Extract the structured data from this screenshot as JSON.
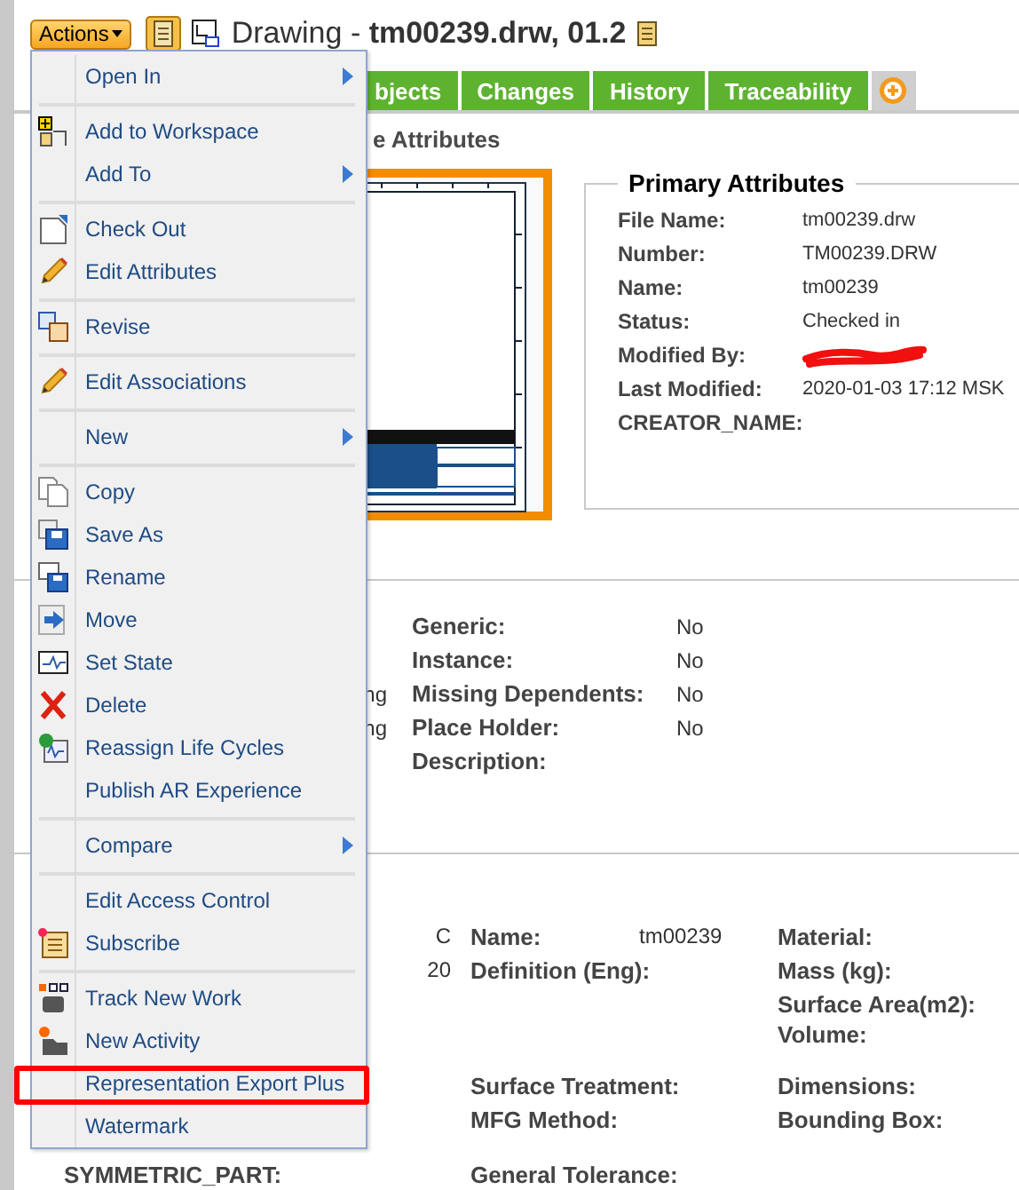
{
  "header": {
    "actions_button": "Actions",
    "title": "Drawing - **tm00239.drw, 01.2**"
  },
  "tabs": [
    {
      "label": "bjects",
      "selected": false
    },
    {
      "label": "Changes",
      "selected": false
    },
    {
      "label": "History",
      "selected": false
    },
    {
      "label": "Traceability",
      "selected": false
    }
  ],
  "section_title": "e Attributes",
  "primary_attributes": {
    "title": "Primary Attributes",
    "fields": [
      {
        "label": "File Name:",
        "value": "tm00239.drw"
      },
      {
        "label": "Number:",
        "value": "TM00239.DRW"
      },
      {
        "label": "Name:",
        "value": "tm00239"
      },
      {
        "label": "Status:",
        "value": "Checked in"
      },
      {
        "label": "Modified By:",
        "redacted": true
      },
      {
        "label": "Last Modified:",
        "value": "2020-01-03 17:12 MSK"
      },
      {
        "label": "CREATOR_NAME:"
      }
    ]
  },
  "details": [
    {
      "label": "Generic:",
      "value": "No"
    },
    {
      "label": "Instance:",
      "value": "No"
    },
    {
      "column_1": "ng",
      "label": "Missing Dependents:",
      "value": "No"
    },
    {
      "column_1": "ng",
      "label": "Place Holder:",
      "value": "No"
    },
    {
      "label": "Description:"
    }
  ],
  "properties": [
    {
      "column_1": "C",
      "label": "Name:",
      "value": "tm00239",
      "label_2": "Material:"
    },
    {
      "column_1": "20",
      "label": "Definition (Eng):",
      "label_2": "Mass (kg):"
    },
    {
      "label_2": "Surface Area(m2):"
    },
    {
      "label_2": "Volume:"
    },
    {
      "label": "Surface Treatment:",
      "label_2": "Dimensions:"
    },
    {
      "label": "MFG Method:",
      "label_2": "Bounding Box:"
    },
    {
      "left_label": "SYMMETRIC_PART:",
      "label": "General Tolerance:"
    }
  ],
  "actions_menu": [
    {
      "kind": "item",
      "label": "Open In",
      "submenu": true,
      "highlighted": false
    },
    {
      "kind": "separator"
    },
    {
      "kind": "item",
      "label": "Add to Workspace",
      "submenu": false,
      "highlighted": false
    },
    {
      "kind": "item",
      "label": "Add To",
      "submenu": true,
      "highlighted": false
    },
    {
      "kind": "separator"
    },
    {
      "kind": "item",
      "label": "Check Out",
      "submenu": false,
      "highlighted": false
    },
    {
      "kind": "item",
      "label": "Edit Attributes",
      "submenu": false,
      "highlighted": false
    },
    {
      "kind": "separator"
    },
    {
      "kind": "item",
      "label": "Revise",
      "submenu": false,
      "highlighted": false
    },
    {
      "kind": "separator"
    },
    {
      "kind": "item",
      "label": "Edit Associations",
      "submenu": false,
      "highlighted": false
    },
    {
      "kind": "separator"
    },
    {
      "kind": "item",
      "label": "New",
      "submenu": true,
      "highlighted": false
    },
    {
      "kind": "separator"
    },
    {
      "kind": "item",
      "label": "Copy",
      "submenu": false,
      "highlighted": false
    },
    {
      "kind": "item",
      "label": "Save As",
      "submenu": false,
      "highlighted": false
    },
    {
      "kind": "item",
      "label": "Rename",
      "submenu": false,
      "highlighted": false
    },
    {
      "kind": "item",
      "label": "Move",
      "submenu": false,
      "highlighted": false
    },
    {
      "kind": "item",
      "label": "Set State",
      "submenu": false,
      "highlighted": false
    },
    {
      "kind": "item",
      "label": "Delete",
      "submenu": false,
      "highlighted": false
    },
    {
      "kind": "item",
      "label": "Reassign Life Cycles",
      "submenu": false,
      "highlighted": false
    },
    {
      "kind": "item",
      "label": "Publish AR Experience",
      "submenu": false,
      "highlighted": false
    },
    {
      "kind": "separator"
    },
    {
      "kind": "item",
      "label": "Compare",
      "submenu": true,
      "highlighted": false
    },
    {
      "kind": "separator"
    },
    {
      "kind": "item",
      "label": "Edit Access Control",
      "submenu": false,
      "highlighted": false
    },
    {
      "kind": "item",
      "label": "Subscribe",
      "submenu": false,
      "highlighted": false
    },
    {
      "kind": "separator"
    },
    {
      "kind": "item",
      "label": "Track New Work",
      "submenu": false,
      "highlighted": false
    },
    {
      "kind": "item",
      "label": "New Activity",
      "submenu": false,
      "highlighted": false
    },
    {
      "kind": "item",
      "label": "Representation Export Plus",
      "submenu": false,
      "highlighted": true
    },
    {
      "kind": "item",
      "label": "Watermark",
      "submenu": false,
      "highlighted": false
    }
  ]
}
